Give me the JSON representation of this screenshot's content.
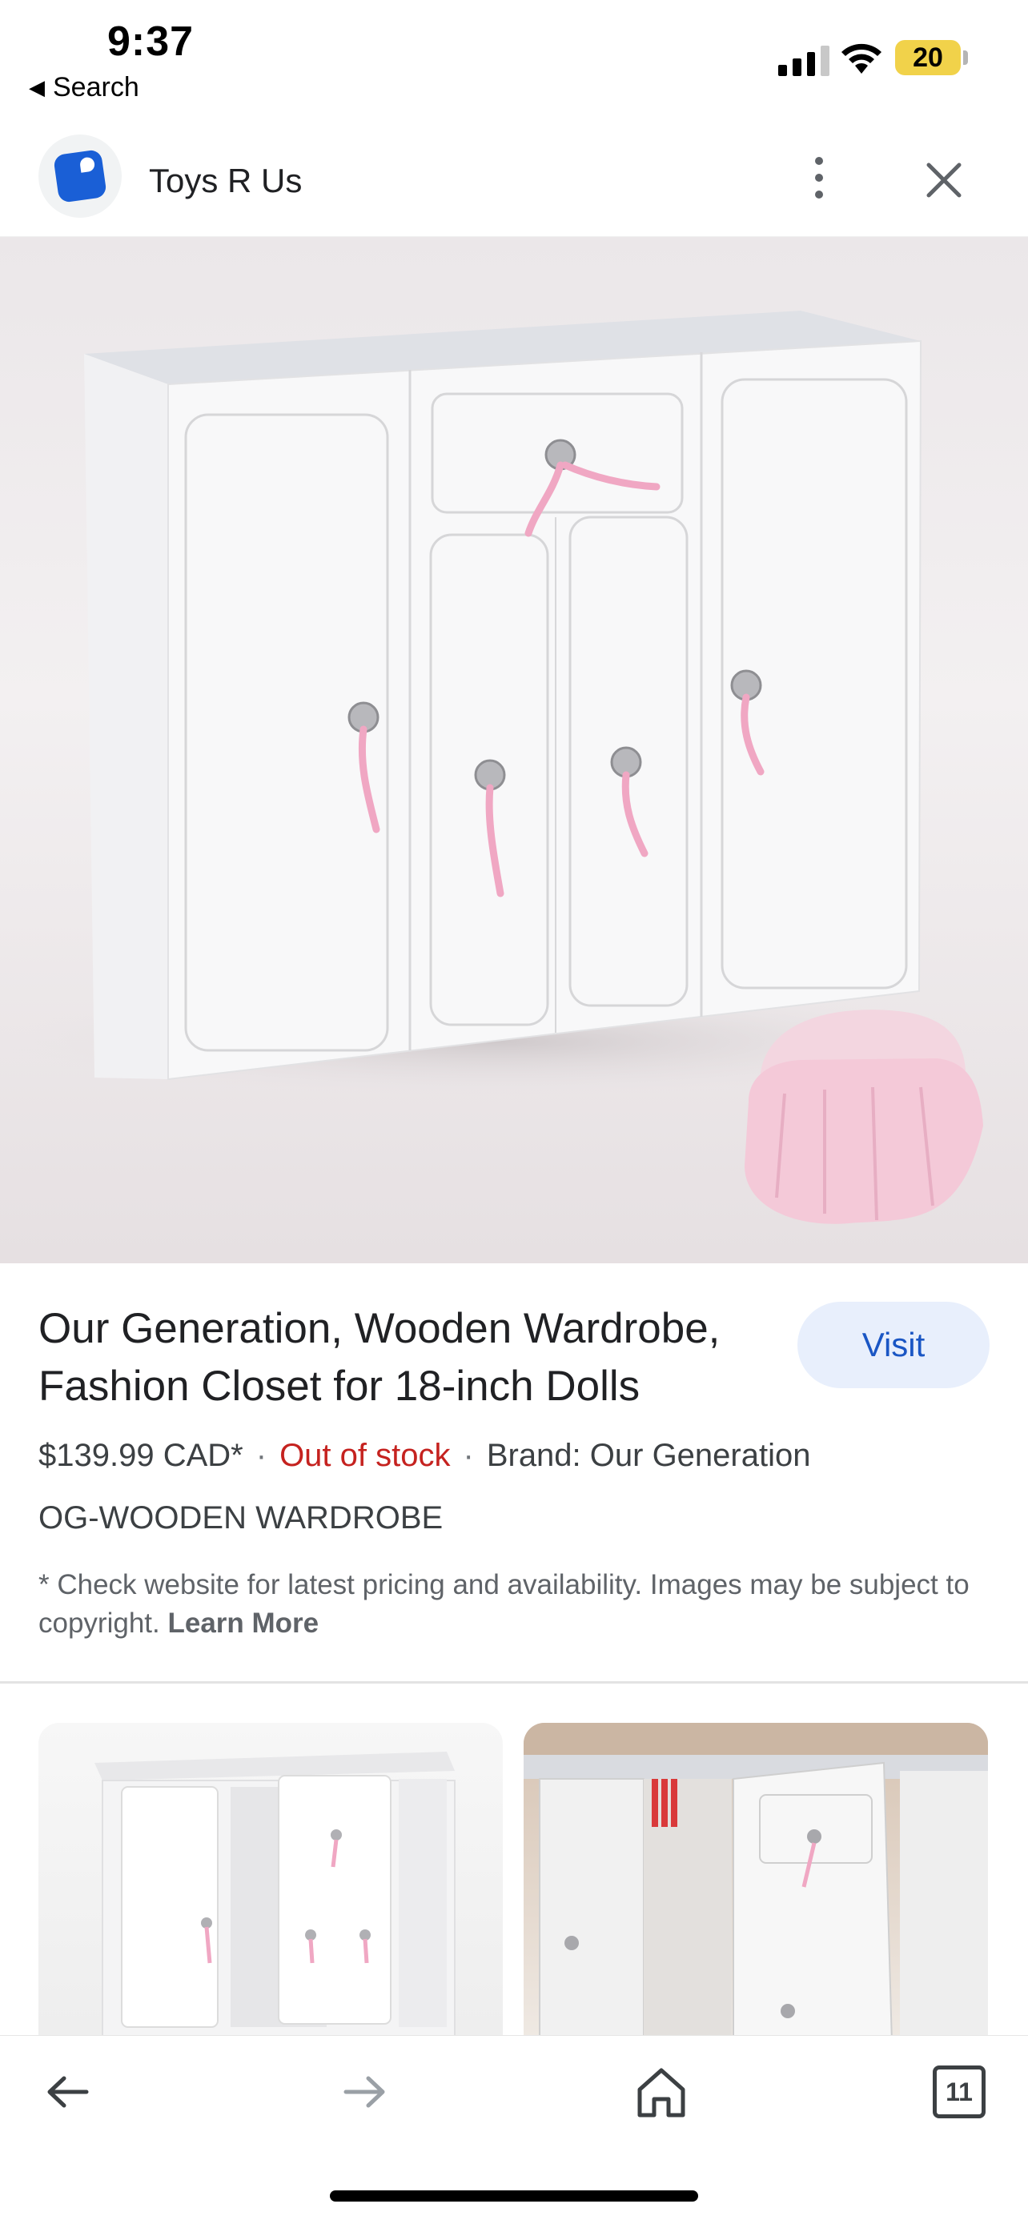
{
  "status_bar": {
    "time": "9:37",
    "back_label": "Search",
    "battery": "20",
    "icons": [
      "signal-icon",
      "wifi-icon",
      "battery-icon"
    ]
  },
  "header": {
    "site_name": "Toys R Us",
    "icons": [
      "toysrus-logo-icon",
      "more-vert-icon",
      "close-icon"
    ]
  },
  "product": {
    "title": "Our Generation, Wooden Wardrobe, Fashion Closet for 18-inch Dolls",
    "visit_label": "Visit",
    "price": "$139.99 CAD*",
    "separator": "·",
    "stock": "Out of stock",
    "brand": "Brand: Our Generation",
    "sku": "OG-WOODEN WARDROBE",
    "disclaimer": "* Check website for latest pricing and availability. Images may be subject to copyright.",
    "learn_more": "Learn More"
  },
  "toolbar": {
    "tabs_count": "11",
    "icons": [
      "back-arrow-icon",
      "forward-arrow-icon",
      "home-icon",
      "tabs-icon"
    ]
  },
  "colors": {
    "accent": "#1a56c4",
    "visit_bg": "#e8effc",
    "out_of_stock": "#c5221f",
    "battery": "#f1d24a"
  }
}
